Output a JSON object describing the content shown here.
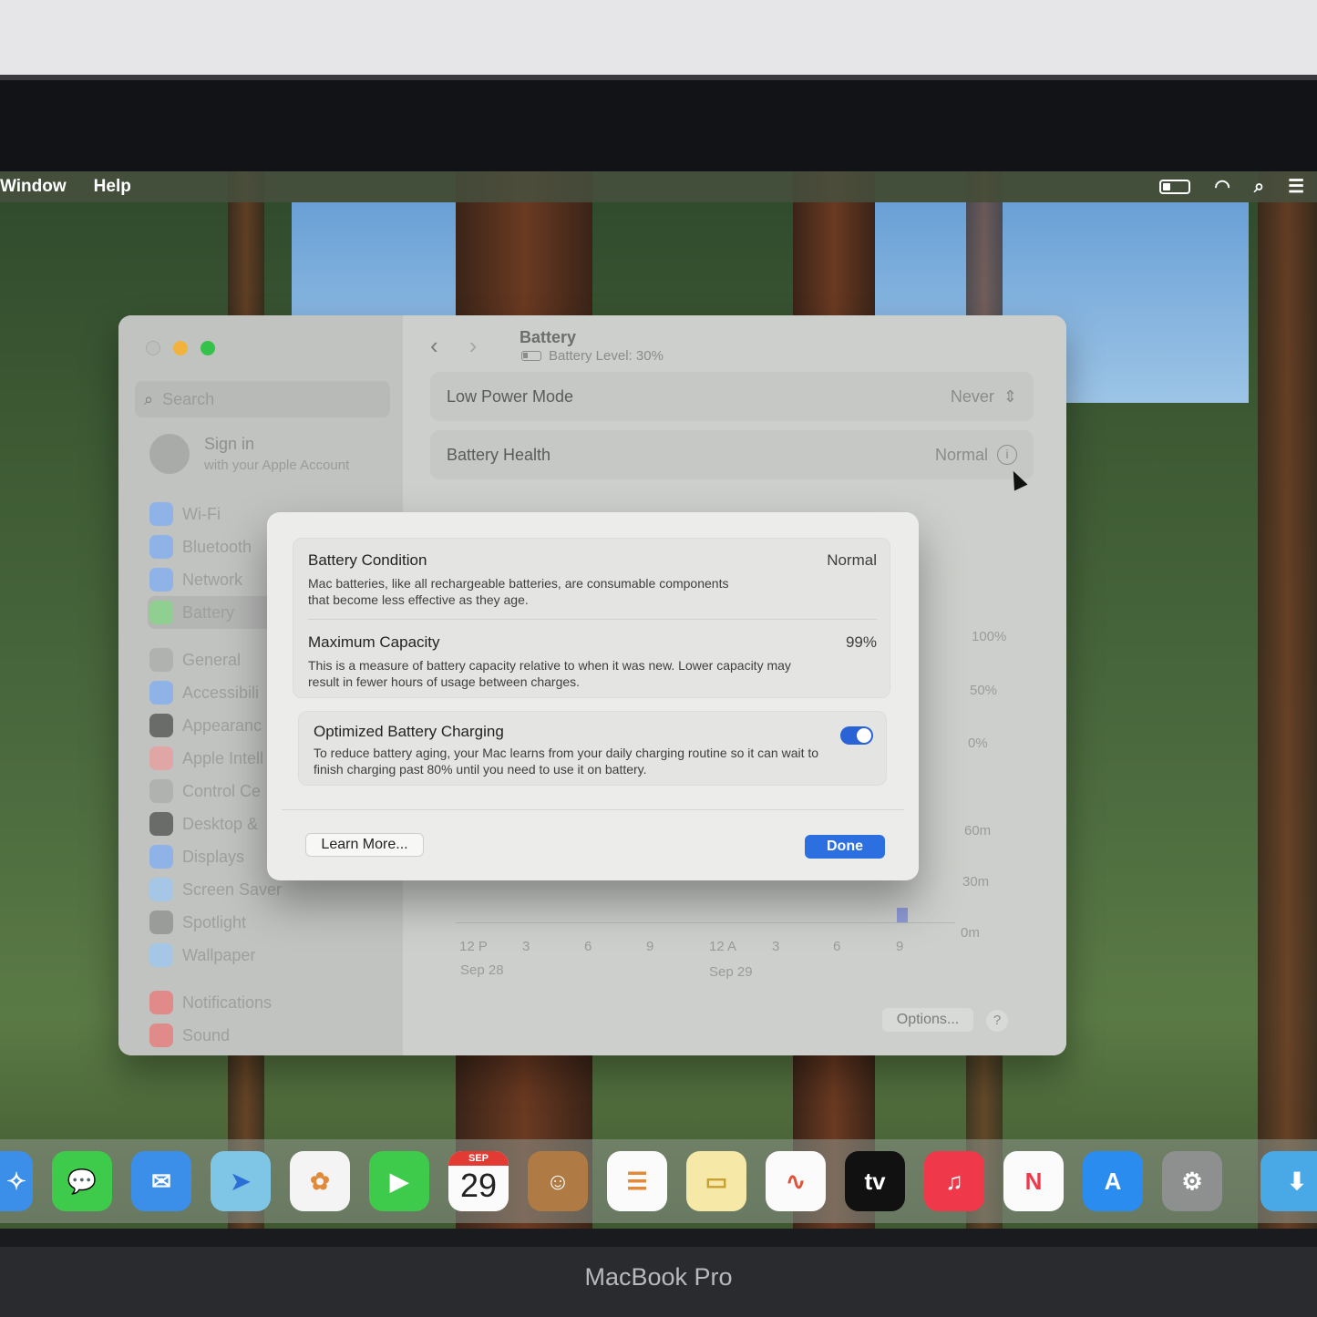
{
  "menubar": {
    "items": [
      "Window",
      "Help"
    ]
  },
  "sidebar": {
    "search_placeholder": "Search",
    "account_title": "Sign in",
    "account_subtitle": "with your Apple Account",
    "items": [
      "Wi-Fi",
      "Bluetooth",
      "Network",
      "Battery",
      "General",
      "Accessibili",
      "Appearanc",
      "Apple Intell",
      "Control Ce",
      "Desktop &",
      "Displays",
      "Screen Saver",
      "Spotlight",
      "Wallpaper",
      "Notifications",
      "Sound"
    ]
  },
  "pane": {
    "title": "Battery",
    "subtitle": "Battery Level: 30%",
    "low_power_label": "Low Power Mode",
    "low_power_value": "Never",
    "health_label": "Battery Health",
    "health_value": "Normal",
    "chart_y_labels": [
      "100%",
      "50%",
      "0%",
      "60m",
      "30m",
      "0m"
    ],
    "chart_x_labels": [
      "12 P",
      "3",
      "6",
      "9",
      "12 A",
      "3",
      "6",
      "9"
    ],
    "chart_dates": [
      "Sep 28",
      "Sep 29"
    ],
    "options_label": "Options...",
    "help_label": "?"
  },
  "modal": {
    "condition_title": "Battery Condition",
    "condition_value": "Normal",
    "condition_desc": "Mac batteries, like all rechargeable batteries, are consumable components that become less effective as they age.",
    "capacity_title": "Maximum Capacity",
    "capacity_value": "99%",
    "capacity_desc": "This is a measure of battery capacity relative to when it was new. Lower capacity may result in fewer hours of usage between charges.",
    "charging_title": "Optimized Battery Charging",
    "charging_desc": "To reduce battery aging, your Mac learns from your daily charging routine so it can wait to finish charging past 80% until you need to use it on battery.",
    "learn_more": "Learn More...",
    "done": "Done"
  },
  "dock": {
    "calendar_month": "SEP",
    "calendar_day": "29",
    "tv_label": "tv"
  },
  "laptop_brand": "MacBook Pro",
  "colors": {
    "accent": "#2c6fe0",
    "toggle": "#2a63d6"
  }
}
